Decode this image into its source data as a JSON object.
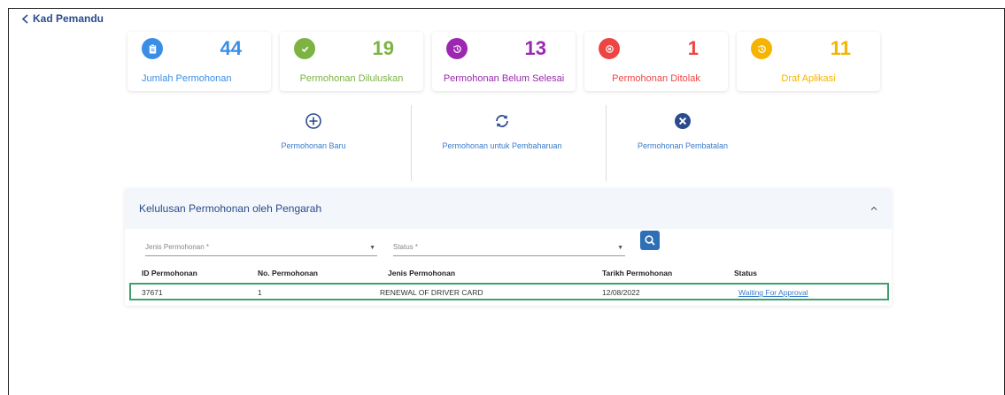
{
  "nav": {
    "back_label": "Kad Pemandu"
  },
  "stats": [
    {
      "icon": "clipboard-icon",
      "color": "#3a8ee6",
      "count": "44",
      "label": "Jumlah Permohonan"
    },
    {
      "icon": "check-circle-icon",
      "color": "#7cb342",
      "count": "19",
      "label": "Permohonan Diluluskan"
    },
    {
      "icon": "clock-history-icon",
      "color": "#9c27b0",
      "count": "13",
      "label": "Permohonan Belum Selesai"
    },
    {
      "icon": "cancel-circle-icon",
      "color": "#ef4444",
      "count": "1",
      "label": "Permohonan Ditolak"
    },
    {
      "icon": "draft-history-icon",
      "color": "#f5b400",
      "count": "11",
      "label": "Draf Aplikasi"
    }
  ],
  "actions": [
    {
      "icon": "plus-circle-icon",
      "label": "Permohonan Baru"
    },
    {
      "icon": "renew-icon",
      "label": "Permohonan untuk Pembaharuan"
    },
    {
      "icon": "cancel-filled-icon",
      "label": "Permohonan Pembatalan"
    }
  ],
  "panel": {
    "title": "Kelulusan Permohonan oleh Pengarah",
    "filters": {
      "jenis_placeholder": "Jenis Permohonan *",
      "status_placeholder": "Status *"
    },
    "columns": [
      "ID Permohonan",
      "No. Permohonan",
      "Jenis Permohonan",
      "Tarikh Permohonan",
      "Status"
    ],
    "rows": [
      {
        "id": "37671",
        "no": "1",
        "jenis": "RENEWAL OF DRIVER CARD",
        "tarikh": "12/08/2022",
        "status": "Waiting For Approval"
      }
    ]
  }
}
